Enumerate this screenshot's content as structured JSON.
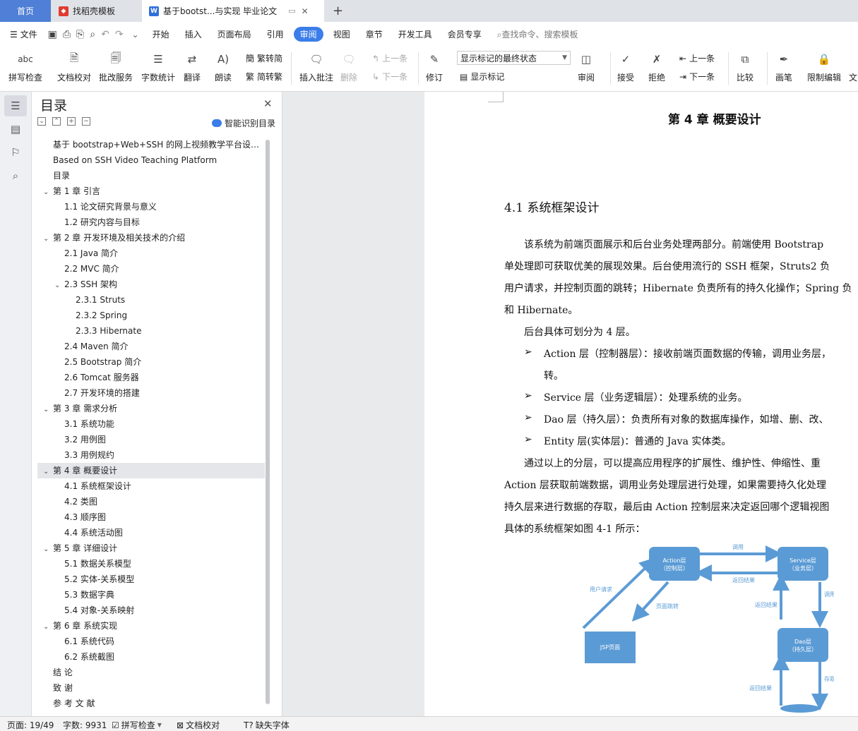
{
  "tabs": [
    {
      "label": "首页"
    },
    {
      "label": "找稻壳模板"
    },
    {
      "label": "基于bootst...与实现 毕业论文"
    }
  ],
  "menu": {
    "file": "文件",
    "items": [
      "开始",
      "插入",
      "页面布局",
      "引用",
      "审阅",
      "视图",
      "章节",
      "开发工具",
      "会员专享"
    ],
    "active_index": 4,
    "search_placeholder": "查找命令、搜索模板"
  },
  "ribbon": {
    "spellcheck": "拼写检查",
    "doc_proof": "文档校对",
    "approve": "批改服务",
    "wordcount": "字数统计",
    "translate": "翻译",
    "read_aloud": "朗读",
    "trad_to_simp": "繁转简",
    "simp_to_trad": "简转繁",
    "insert_comment": "插入批注",
    "delete": "删除",
    "prev_comment": "上一条",
    "next_comment": "下一条",
    "revise": "修订",
    "markup_state": "显示标记的最终状态",
    "show_markup": "显示标记",
    "review": "审阅",
    "accept": "接受",
    "reject": "拒绝",
    "prev_change": "上一条",
    "next_change": "下一条",
    "compare": "比较",
    "pen": "画笔",
    "restrict_edit": "限制编辑",
    "doc_cut": "文"
  },
  "toc": {
    "title": "目录",
    "smart_label": "智能识别目录",
    "items": [
      {
        "label": "基于 bootstrap+Web+SSH 的网上视频教学平台设计与实现",
        "level": 0,
        "toggle": ""
      },
      {
        "label": "Based on SSH Video Teaching Platform",
        "level": 0,
        "toggle": ""
      },
      {
        "label": "目录",
        "level": 0,
        "toggle": ""
      },
      {
        "label": "第 1 章  引言",
        "level": 0,
        "toggle": "v"
      },
      {
        "label": "1.1  论文研究背景与意义",
        "level": 1,
        "toggle": ""
      },
      {
        "label": "1.2  研究内容与目标",
        "level": 1,
        "toggle": ""
      },
      {
        "label": "第 2 章  开发环境及相关技术的介绍",
        "level": 0,
        "toggle": "v"
      },
      {
        "label": "2.1 Java 简介",
        "level": 1,
        "toggle": ""
      },
      {
        "label": "2.2 MVC 简介",
        "level": 1,
        "toggle": ""
      },
      {
        "label": "2.3 SSH 架构",
        "level": 1,
        "toggle": "v"
      },
      {
        "label": "2.3.1 Struts",
        "level": 2,
        "toggle": ""
      },
      {
        "label": "2.3.2 Spring",
        "level": 2,
        "toggle": ""
      },
      {
        "label": "2.3.3 Hibernate",
        "level": 2,
        "toggle": ""
      },
      {
        "label": "2.4 Maven 简介",
        "level": 1,
        "toggle": ""
      },
      {
        "label": "2.5 Bootstrap 简介",
        "level": 1,
        "toggle": ""
      },
      {
        "label": "2.6 Tomcat 服务器",
        "level": 1,
        "toggle": ""
      },
      {
        "label": "2.7  开发环境的搭建",
        "level": 1,
        "toggle": ""
      },
      {
        "label": "第 3 章  需求分析",
        "level": 0,
        "toggle": "v"
      },
      {
        "label": "3.1  系统功能",
        "level": 1,
        "toggle": ""
      },
      {
        "label": "3.2  用例图",
        "level": 1,
        "toggle": ""
      },
      {
        "label": "3.3  用例规约",
        "level": 1,
        "toggle": ""
      },
      {
        "label": "第 4 章  概要设计",
        "level": 0,
        "toggle": "v",
        "selected": true
      },
      {
        "label": "4.1  系统框架设计",
        "level": 1,
        "toggle": ""
      },
      {
        "label": "4.2  类图",
        "level": 1,
        "toggle": ""
      },
      {
        "label": "4.3  顺序图",
        "level": 1,
        "toggle": ""
      },
      {
        "label": "4.4  系统活动图",
        "level": 1,
        "toggle": ""
      },
      {
        "label": "第 5 章  详细设计",
        "level": 0,
        "toggle": "v"
      },
      {
        "label": "5.1  数据关系模型",
        "level": 1,
        "toggle": ""
      },
      {
        "label": "5.2  实体-关系模型",
        "level": 1,
        "toggle": ""
      },
      {
        "label": "5.3  数据字典",
        "level": 1,
        "toggle": ""
      },
      {
        "label": "5.4  对象-关系映射",
        "level": 1,
        "toggle": ""
      },
      {
        "label": "第 6 章  系统实现",
        "level": 0,
        "toggle": "v"
      },
      {
        "label": "6.1  系统代码",
        "level": 1,
        "toggle": ""
      },
      {
        "label": "6.2  系统截图",
        "level": 1,
        "toggle": ""
      },
      {
        "label": "结    论",
        "level": 0,
        "toggle": ""
      },
      {
        "label": "致    谢",
        "level": 0,
        "toggle": ""
      },
      {
        "label": "参 考 文 献",
        "level": 0,
        "toggle": ""
      }
    ]
  },
  "document": {
    "chapter_title": "第 4 章  概要设计",
    "section_title": "4.1  系统框架设计",
    "lines": [
      "　　该系统为前端页面展示和后台业务处理两部分。前端使用 Bootstrap",
      "单处理即可获取优美的展现效果。后台使用流行的 SSH 框架，Struts2 负",
      "用户请求，并控制页面的跳转；Hibernate 负责所有的持久化操作；Spring 负",
      "和 Hibernate。",
      "　　后台具体可划分为 4 层。"
    ],
    "bullets": [
      "Action 层（控制器层）：接收前端页面数据的传输，调用业务层，",
      "转。",
      "Service 层（业务逻辑层）：处理系统的业务。",
      "Dao 层（持久层）：负责所有对象的数据库操作，如增、删、改、",
      "Entity 层(实体层)：普通的 Java 实体类。"
    ],
    "lines2": [
      "　　通过以上的分层，可以提高应用程序的扩展性、维护性、伸缩性、重",
      "Action 层获取前端数据，调用业务处理层进行处理，如果需要持久化处理",
      "持久层来进行数据的存取，最后由 Action 控制层来决定返回哪个逻辑视图",
      "具体的系统框架如图 4-1 所示："
    ],
    "diagram": {
      "action": [
        "Action层",
        "（控制层）"
      ],
      "service": [
        "Service层",
        "（业务层）"
      ],
      "dao": [
        "Dao层",
        "（持久层）"
      ],
      "jsp": "JSP页面",
      "labels": {
        "call1": "调用",
        "return1": "返回结果",
        "user_request": "用户请求",
        "page_jump": "页面跳转",
        "return2": "返回结果",
        "call2": "调用",
        "return3": "返回结果",
        "store": "存取"
      }
    }
  },
  "status": {
    "page": "页面: 19/49",
    "words": "字数: 9931",
    "spell": "拼写检查",
    "proof": "文档校对",
    "missing_font": "缺失字体"
  },
  "colors": {
    "accent": "#3b7de9",
    "diagram_box": "#5b9bd5",
    "home_tab": "#4f7fd6"
  }
}
